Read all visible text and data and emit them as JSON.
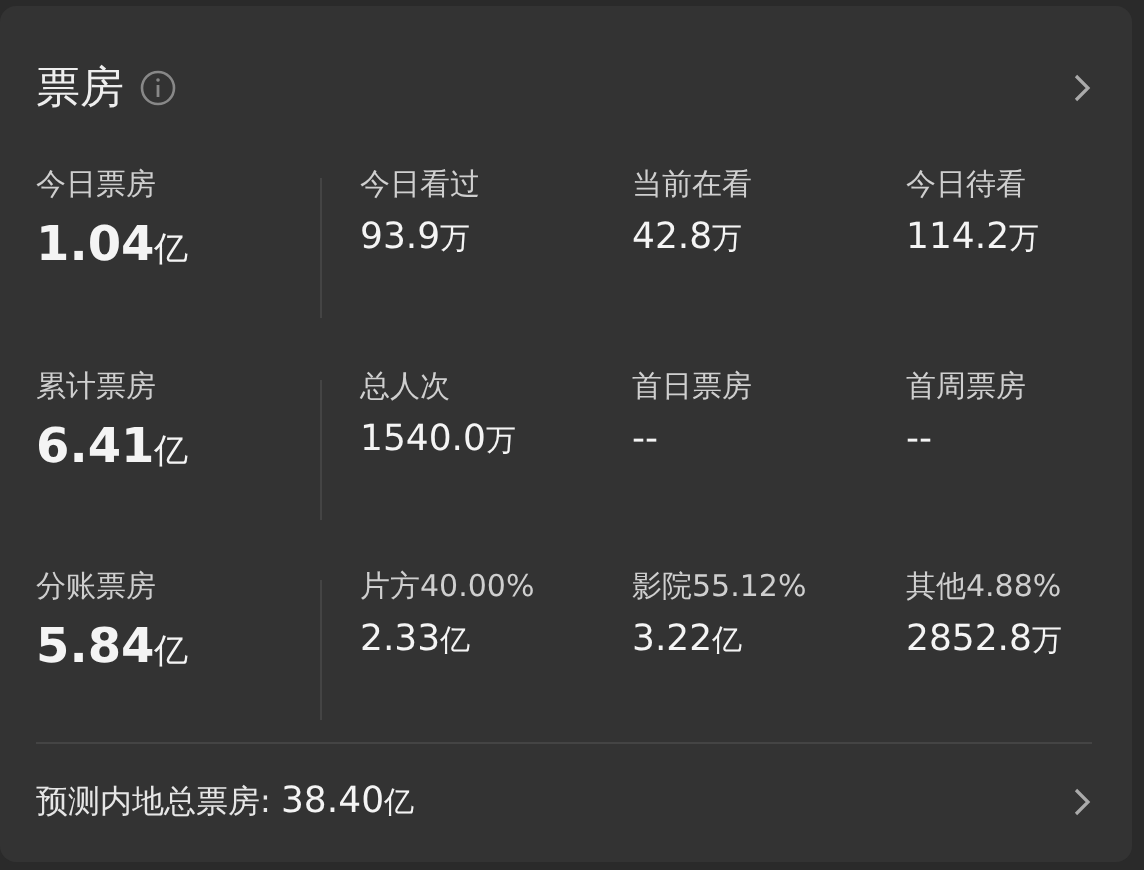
{
  "header": {
    "title": "票房"
  },
  "rows": [
    {
      "main": {
        "label": "今日票房",
        "number": "1.04",
        "unit": "亿"
      },
      "stats": [
        {
          "label": "今日看过",
          "number": "93.9",
          "unit": "万"
        },
        {
          "label": "当前在看",
          "number": "42.8",
          "unit": "万"
        },
        {
          "label": "今日待看",
          "number": "114.2",
          "unit": "万"
        }
      ]
    },
    {
      "main": {
        "label": "累计票房",
        "number": "6.41",
        "unit": "亿"
      },
      "stats": [
        {
          "label": "总人次",
          "number": "1540.0",
          "unit": "万"
        },
        {
          "label": "首日票房",
          "number": "--"
        },
        {
          "label": "首周票房",
          "number": "--"
        }
      ]
    },
    {
      "main": {
        "label": "分账票房",
        "number": "5.84",
        "unit": "亿"
      },
      "stats": [
        {
          "label": "片方40.00%",
          "number": "2.33",
          "unit": "亿"
        },
        {
          "label": "影院55.12%",
          "number": "3.22",
          "unit": "亿"
        },
        {
          "label": "其他4.88%",
          "number": "2852.8",
          "unit": "万"
        }
      ]
    }
  ],
  "footer": {
    "label": "预测内地总票房:",
    "number": "38.40",
    "unit": "亿"
  }
}
